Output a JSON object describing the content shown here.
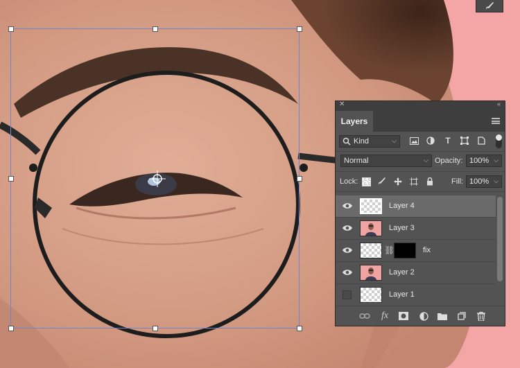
{
  "canvas": {
    "background_color": "#f4a6a6",
    "skin_color": "#d69d86"
  },
  "tool_button": {
    "icon": "brush-icon"
  },
  "layers_panel": {
    "tab_label": "Layers",
    "filter": {
      "kind_label": "Kind"
    },
    "blend_mode": "Normal",
    "opacity_label": "Opacity:",
    "opacity_value": "100%",
    "lock_label": "Lock:",
    "fill_label": "Fill:",
    "fill_value": "100%",
    "layers": [
      {
        "name": "Layer 4",
        "visible": true,
        "selected": true,
        "thumb": "transparent"
      },
      {
        "name": "Layer 3",
        "visible": true,
        "selected": false,
        "thumb": "photo"
      },
      {
        "name": "fix",
        "visible": true,
        "selected": false,
        "thumb": "transparent-with-mask"
      },
      {
        "name": "Layer 2",
        "visible": true,
        "selected": false,
        "thumb": "photo"
      },
      {
        "name": "Layer 1",
        "visible": false,
        "selected": false,
        "thumb": "transparent"
      }
    ],
    "bottom_icons": [
      "link-icon",
      "fx-icon",
      "mask-icon",
      "adjustment-icon",
      "folder-icon",
      "new-layer-icon",
      "trash-icon"
    ]
  }
}
